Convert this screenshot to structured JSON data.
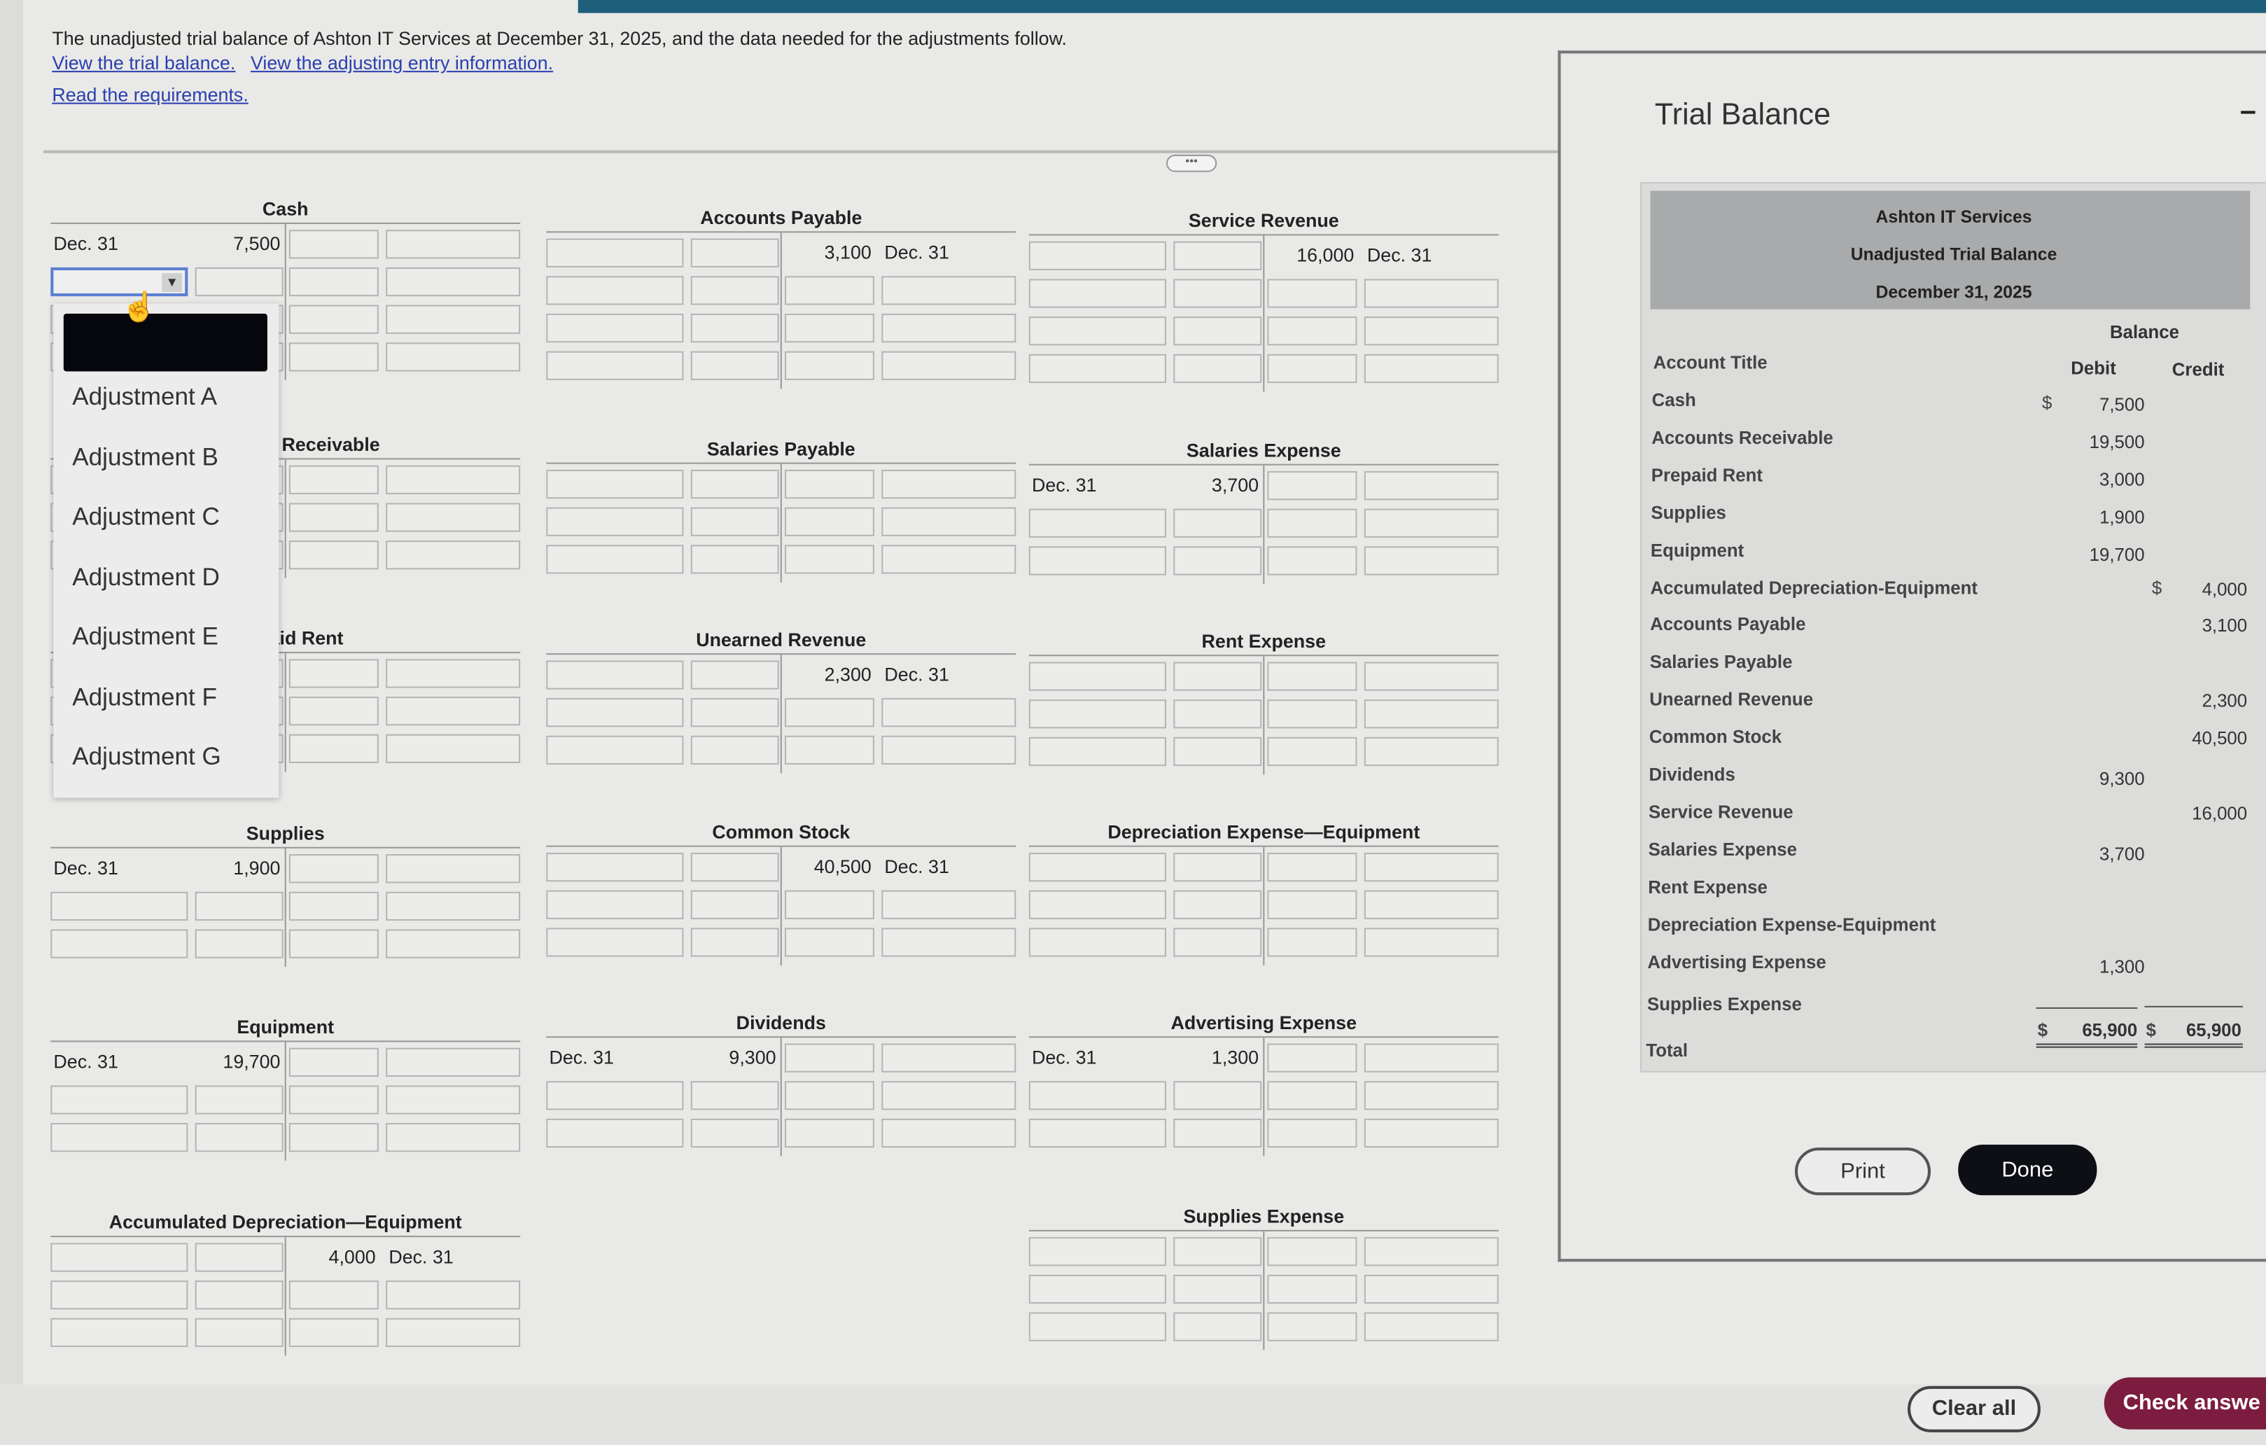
{
  "intro": {
    "text": "The unadjusted trial balance of Ashton IT Services at December 31, 2025, and the data needed for the adjustments follow.",
    "link_trial_balance": "View the trial balance.",
    "link_adjusting": "View the adjusting entry information.",
    "link_requirements": "Read the requirements."
  },
  "splitter": "•••",
  "t_accounts": [
    {
      "title": "Accounts Receivable",
      "rows": [
        {},
        {},
        {}
      ]
    },
    {
      "title": "Prepaid Rent",
      "rows": [
        {},
        {},
        {}
      ]
    },
    {
      "title": "Cash",
      "rows": [
        {
          "ldate": "Dec. 31",
          "lamt": "7,500"
        },
        {
          "dropdown": true
        },
        {},
        {}
      ]
    },
    {
      "title": "Supplies",
      "rows": [
        {
          "ldate": "Dec. 31",
          "lamt": "1,900"
        },
        {},
        {}
      ]
    },
    {
      "title": "Equipment",
      "rows": [
        {
          "ldate": "Dec. 31",
          "lamt": "19,700"
        },
        {},
        {}
      ]
    },
    {
      "title": "Accumulated Depreciation—Equipment",
      "rows": [
        {
          "ramt": "4,000",
          "rdate": "Dec. 31"
        },
        {},
        {}
      ]
    },
    {
      "title": "Accounts Payable",
      "rows": [
        {
          "ramt": "3,100",
          "rdate": "Dec. 31"
        },
        {},
        {},
        {}
      ]
    },
    {
      "title": "Salaries Payable",
      "rows": [
        {},
        {},
        {}
      ]
    },
    {
      "title": "Unearned Revenue",
      "rows": [
        {
          "ramt": "2,300",
          "rdate": "Dec. 31"
        },
        {},
        {}
      ]
    },
    {
      "title": "Common Stock",
      "rows": [
        {
          "ramt": "40,500",
          "rdate": "Dec. 31"
        },
        {},
        {}
      ]
    },
    {
      "title": "Dividends",
      "rows": [
        {
          "ldate": "Dec. 31",
          "lamt": "9,300"
        },
        {},
        {}
      ]
    },
    {
      "title": "Service Revenue",
      "rows": [
        {
          "ramt": "16,000",
          "rdate": "Dec. 31"
        },
        {},
        {},
        {}
      ]
    },
    {
      "title": "Salaries Expense",
      "rows": [
        {
          "ldate": "Dec. 31",
          "lamt": "3,700"
        },
        {},
        {}
      ]
    },
    {
      "title": "Rent Expense",
      "rows": [
        {},
        {},
        {}
      ]
    },
    {
      "title": "Depreciation Expense—Equipment",
      "rows": [
        {},
        {},
        {}
      ]
    },
    {
      "title": "Advertising Expense",
      "rows": [
        {
          "ldate": "Dec. 31",
          "lamt": "1,300"
        },
        {},
        {}
      ]
    },
    {
      "title": "Supplies Expense",
      "rows": [
        {},
        {},
        {}
      ]
    }
  ],
  "dropdown": {
    "selected": "",
    "options": [
      "Adjustment A",
      "Adjustment B",
      "Adjustment C",
      "Adjustment D",
      "Adjustment E",
      "Adjustment F",
      "Adjustment G"
    ]
  },
  "trial_balance": {
    "panel_title": "Trial Balance",
    "company": "Ashton IT Services",
    "report": "Unadjusted Trial Balance",
    "date": "December 31, 2025",
    "balance_header": "Balance",
    "col_title": "Account Title",
    "col_debit": "Debit",
    "col_credit": "Credit",
    "rows": [
      {
        "title": "Cash",
        "debit": "7,500",
        "debit_sign": "$"
      },
      {
        "title": "Accounts Receivable",
        "debit": "19,500"
      },
      {
        "title": "Prepaid Rent",
        "debit": "3,000"
      },
      {
        "title": "Supplies",
        "debit": "1,900"
      },
      {
        "title": "Equipment",
        "debit": "19,700"
      },
      {
        "title": "Accumulated Depreciation-Equipment",
        "credit": "4,000",
        "credit_sign": "$"
      },
      {
        "title": "Accounts Payable",
        "credit": "3,100"
      },
      {
        "title": "Salaries Payable"
      },
      {
        "title": "Unearned Revenue",
        "credit": "2,300"
      },
      {
        "title": "Common Stock",
        "credit": "40,500"
      },
      {
        "title": "Dividends",
        "debit": "9,300"
      },
      {
        "title": "Service Revenue",
        "credit": "16,000"
      },
      {
        "title": "Salaries Expense",
        "debit": "3,700"
      },
      {
        "title": "Rent Expense"
      },
      {
        "title": "Depreciation Expense-Equipment"
      },
      {
        "title": "Advertising Expense",
        "debit": "1,300"
      },
      {
        "title": "Supplies Expense"
      }
    ],
    "total": {
      "title": "Total",
      "debit_sign": "$",
      "debit": "65,900",
      "credit_sign": "$",
      "credit": "65,900"
    },
    "print_label": "Print",
    "done_label": "Done"
  },
  "footer": {
    "clear_all": "Clear all",
    "check_answer": "Check answe"
  },
  "colors": {
    "accent": "#1e5f7c",
    "check_button": "#7c1d3f",
    "done_button": "#0d0f14",
    "link": "#2a3fb0"
  }
}
